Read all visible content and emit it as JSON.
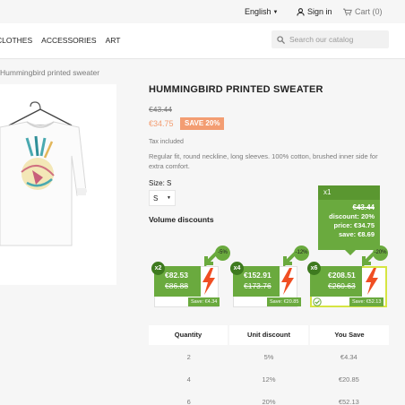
{
  "topbar": {
    "language": "English",
    "signin": "Sign in",
    "cart": "Cart (0)"
  },
  "nav": {
    "items": [
      "CLOTHES",
      "ACCESSORIES",
      "ART"
    ]
  },
  "search": {
    "placeholder": "Search our catalog"
  },
  "breadcrumb": "Hummingbird printed sweater",
  "product": {
    "title": "HUMMINGBIRD PRINTED SWEATER",
    "old_price": "€43.44",
    "price": "€34.75",
    "save_badge": "SAVE 20%",
    "tax": "Tax included",
    "description": "Regular fit, round neckline, long sleeves. 100% cotton, brushed inner side for extra comfort.",
    "size_label": "Size: S",
    "size_value": "S"
  },
  "volume": {
    "title": "Volume discounts",
    "tooltip": {
      "qty": "x1",
      "old": "€43.44",
      "discount": "discount: 20%",
      "price": "price: €34.75",
      "save": "save: €8.69"
    },
    "cards": [
      {
        "qty": "x2",
        "price": "€82.53",
        "old": "€86.88",
        "save": "Save: €4.34",
        "pct": "-5%"
      },
      {
        "qty": "x4",
        "price": "€152.91",
        "old": "€173.76",
        "save": "Save: €20.85",
        "pct": "-12%"
      },
      {
        "qty": "x6",
        "price": "€208.51",
        "old": "€260.63",
        "save": "Save: €52.13",
        "pct": "-20%"
      }
    ]
  },
  "table": {
    "headers": [
      "Quantity",
      "Unit discount",
      "You Save"
    ],
    "rows": [
      [
        "2",
        "5%",
        "€4.34"
      ],
      [
        "4",
        "12%",
        "€20.85"
      ],
      [
        "6",
        "20%",
        "€52.13"
      ]
    ]
  },
  "colors": {
    "green": "#6aaa3e",
    "dark_green": "#3e7a1f",
    "orange": "#f39d72",
    "lightning": "#f04e23"
  }
}
